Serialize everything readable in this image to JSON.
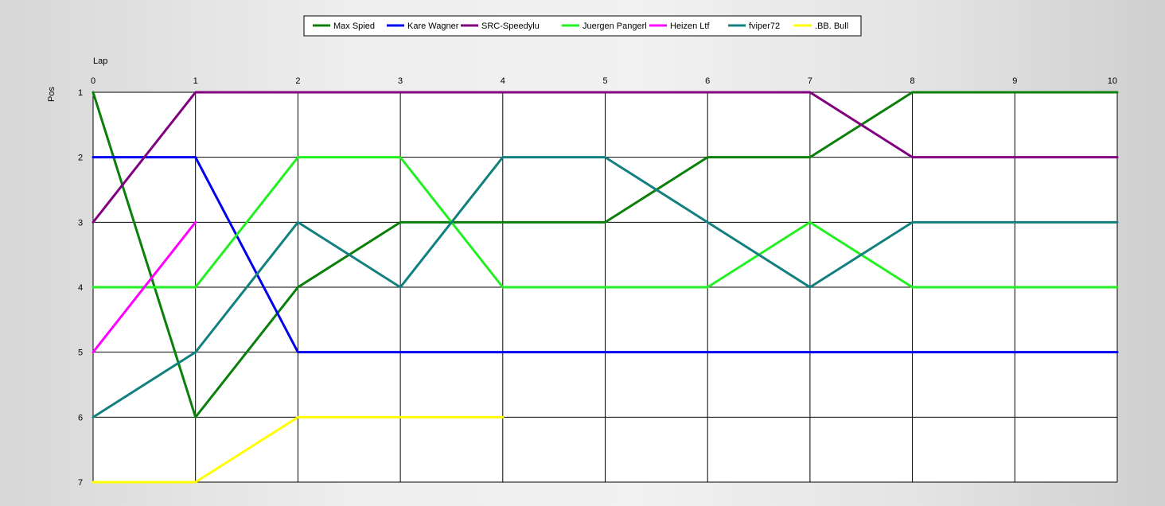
{
  "chart_data": {
    "type": "line",
    "xlabel": "Lap",
    "ylabel": "Pos",
    "xlim": [
      0,
      10
    ],
    "ylim": [
      1,
      7
    ],
    "y_inverted": true,
    "x_ticks": [
      0,
      1,
      2,
      3,
      4,
      5,
      6,
      7,
      8,
      9,
      10
    ],
    "y_ticks": [
      1,
      2,
      3,
      4,
      5,
      6,
      7
    ],
    "x_tick_position": "top",
    "grid": true,
    "legend_position": "top-center",
    "plot_background": "#ffffff",
    "grid_color": "#000000",
    "series": [
      {
        "name": "Max Spied",
        "color": "#0a800a",
        "x": [
          0,
          1,
          2,
          3,
          4,
          5,
          6,
          7,
          8,
          9,
          10
        ],
        "y": [
          1,
          6,
          4,
          3,
          3,
          3,
          2,
          2,
          1,
          1,
          1
        ]
      },
      {
        "name": "Kare Wagner",
        "color": "#0000ee",
        "x": [
          0,
          1,
          2,
          3,
          4,
          5,
          6,
          7,
          8,
          9,
          10
        ],
        "y": [
          2,
          2,
          5,
          5,
          5,
          5,
          5,
          5,
          5,
          5,
          5
        ]
      },
      {
        "name": "SRC-Speedylu",
        "color": "#800080",
        "x": [
          0,
          1,
          2,
          3,
          4,
          5,
          6,
          7,
          8,
          9,
          10
        ],
        "y": [
          3,
          1,
          1,
          1,
          1,
          1,
          1,
          1,
          2,
          2,
          2
        ]
      },
      {
        "name": "Juergen Pangerl",
        "color": "#22f022",
        "x": [
          0,
          1,
          2,
          3,
          4,
          5,
          6,
          7,
          8,
          9,
          10
        ],
        "y": [
          4,
          4,
          2,
          2,
          4,
          4,
          4,
          3,
          4,
          4,
          4
        ]
      },
      {
        "name": "Heizen Ltf",
        "color": "#ff00ff",
        "x": [
          0,
          1
        ],
        "y": [
          5,
          3
        ]
      },
      {
        "name": "fviper72",
        "color": "#138080",
        "x": [
          0,
          1,
          2,
          3,
          4,
          5,
          6,
          7,
          8,
          9,
          10
        ],
        "y": [
          6,
          5,
          3,
          4,
          2,
          2,
          3,
          4,
          3,
          3,
          3
        ]
      },
      {
        "name": ".BB. Bull",
        "color": "#ffff00",
        "x": [
          0,
          1,
          2,
          3,
          4
        ],
        "y": [
          7,
          7,
          6,
          6,
          6
        ]
      }
    ]
  }
}
